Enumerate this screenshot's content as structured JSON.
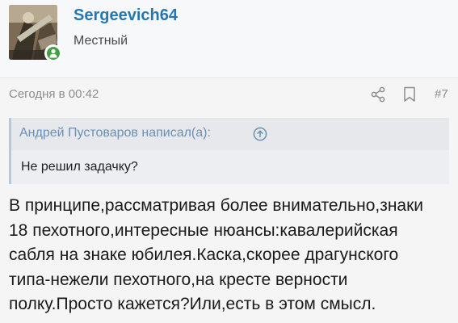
{
  "user": {
    "username": "Sergeevich64",
    "title": "Местный"
  },
  "post": {
    "date": "Сегодня в 00:42",
    "number": "#7"
  },
  "quote": {
    "author": "Андрей Пустоваров написал(а):",
    "text": "Не решил задачку?"
  },
  "message": {
    "lines": [
      "В принципе,рассматривая более внимательно,знаки",
      "18 пехотного,интересные нюансы:кавалерийская",
      "сабля на знаке юбилея.Каска,скорее драгунского",
      "типа-нежели пехотного,на кресте верности",
      "полку.Просто кажется?Или,есть в этом смысл."
    ]
  },
  "colors": {
    "accent": "#2577b1",
    "online": "#43a047",
    "quote_border": "#b9c7d6"
  },
  "icons": {
    "share": "share-icon",
    "bookmark": "bookmark-icon",
    "quote_jump": "arrow-up-circle-icon",
    "online": "user-online-icon"
  }
}
